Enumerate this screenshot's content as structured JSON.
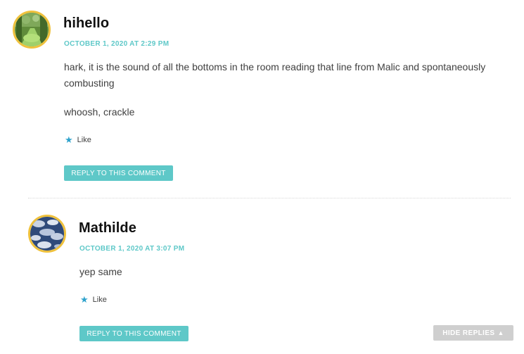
{
  "comments": [
    {
      "author": "hihello",
      "date": "OCTOBER 1, 2020 AT 2:29 PM",
      "paragraphs": [
        "hark, it is the sound of all the bottoms in the room reading that line from Malic and spontaneously combusting",
        "whoosh, crackle"
      ],
      "like_label": "Like",
      "like_icon": "star-icon",
      "reply_label": "REPLY TO THIS COMMENT"
    },
    {
      "author": "Mathilde",
      "date": "OCTOBER 1, 2020 AT 3:07 PM",
      "paragraphs": [
        "yep same"
      ],
      "like_label": "Like",
      "like_icon": "star-icon",
      "reply_label": "REPLY TO THIS COMMENT"
    }
  ],
  "hide_replies": {
    "label": "HIDE REPLIES",
    "icon": "triangle-up-icon"
  },
  "colors": {
    "accent": "#5ec8c8",
    "avatar_ring": "#efc13c",
    "like_star": "#2ea2cc",
    "hide_button": "#cfcfcf"
  }
}
